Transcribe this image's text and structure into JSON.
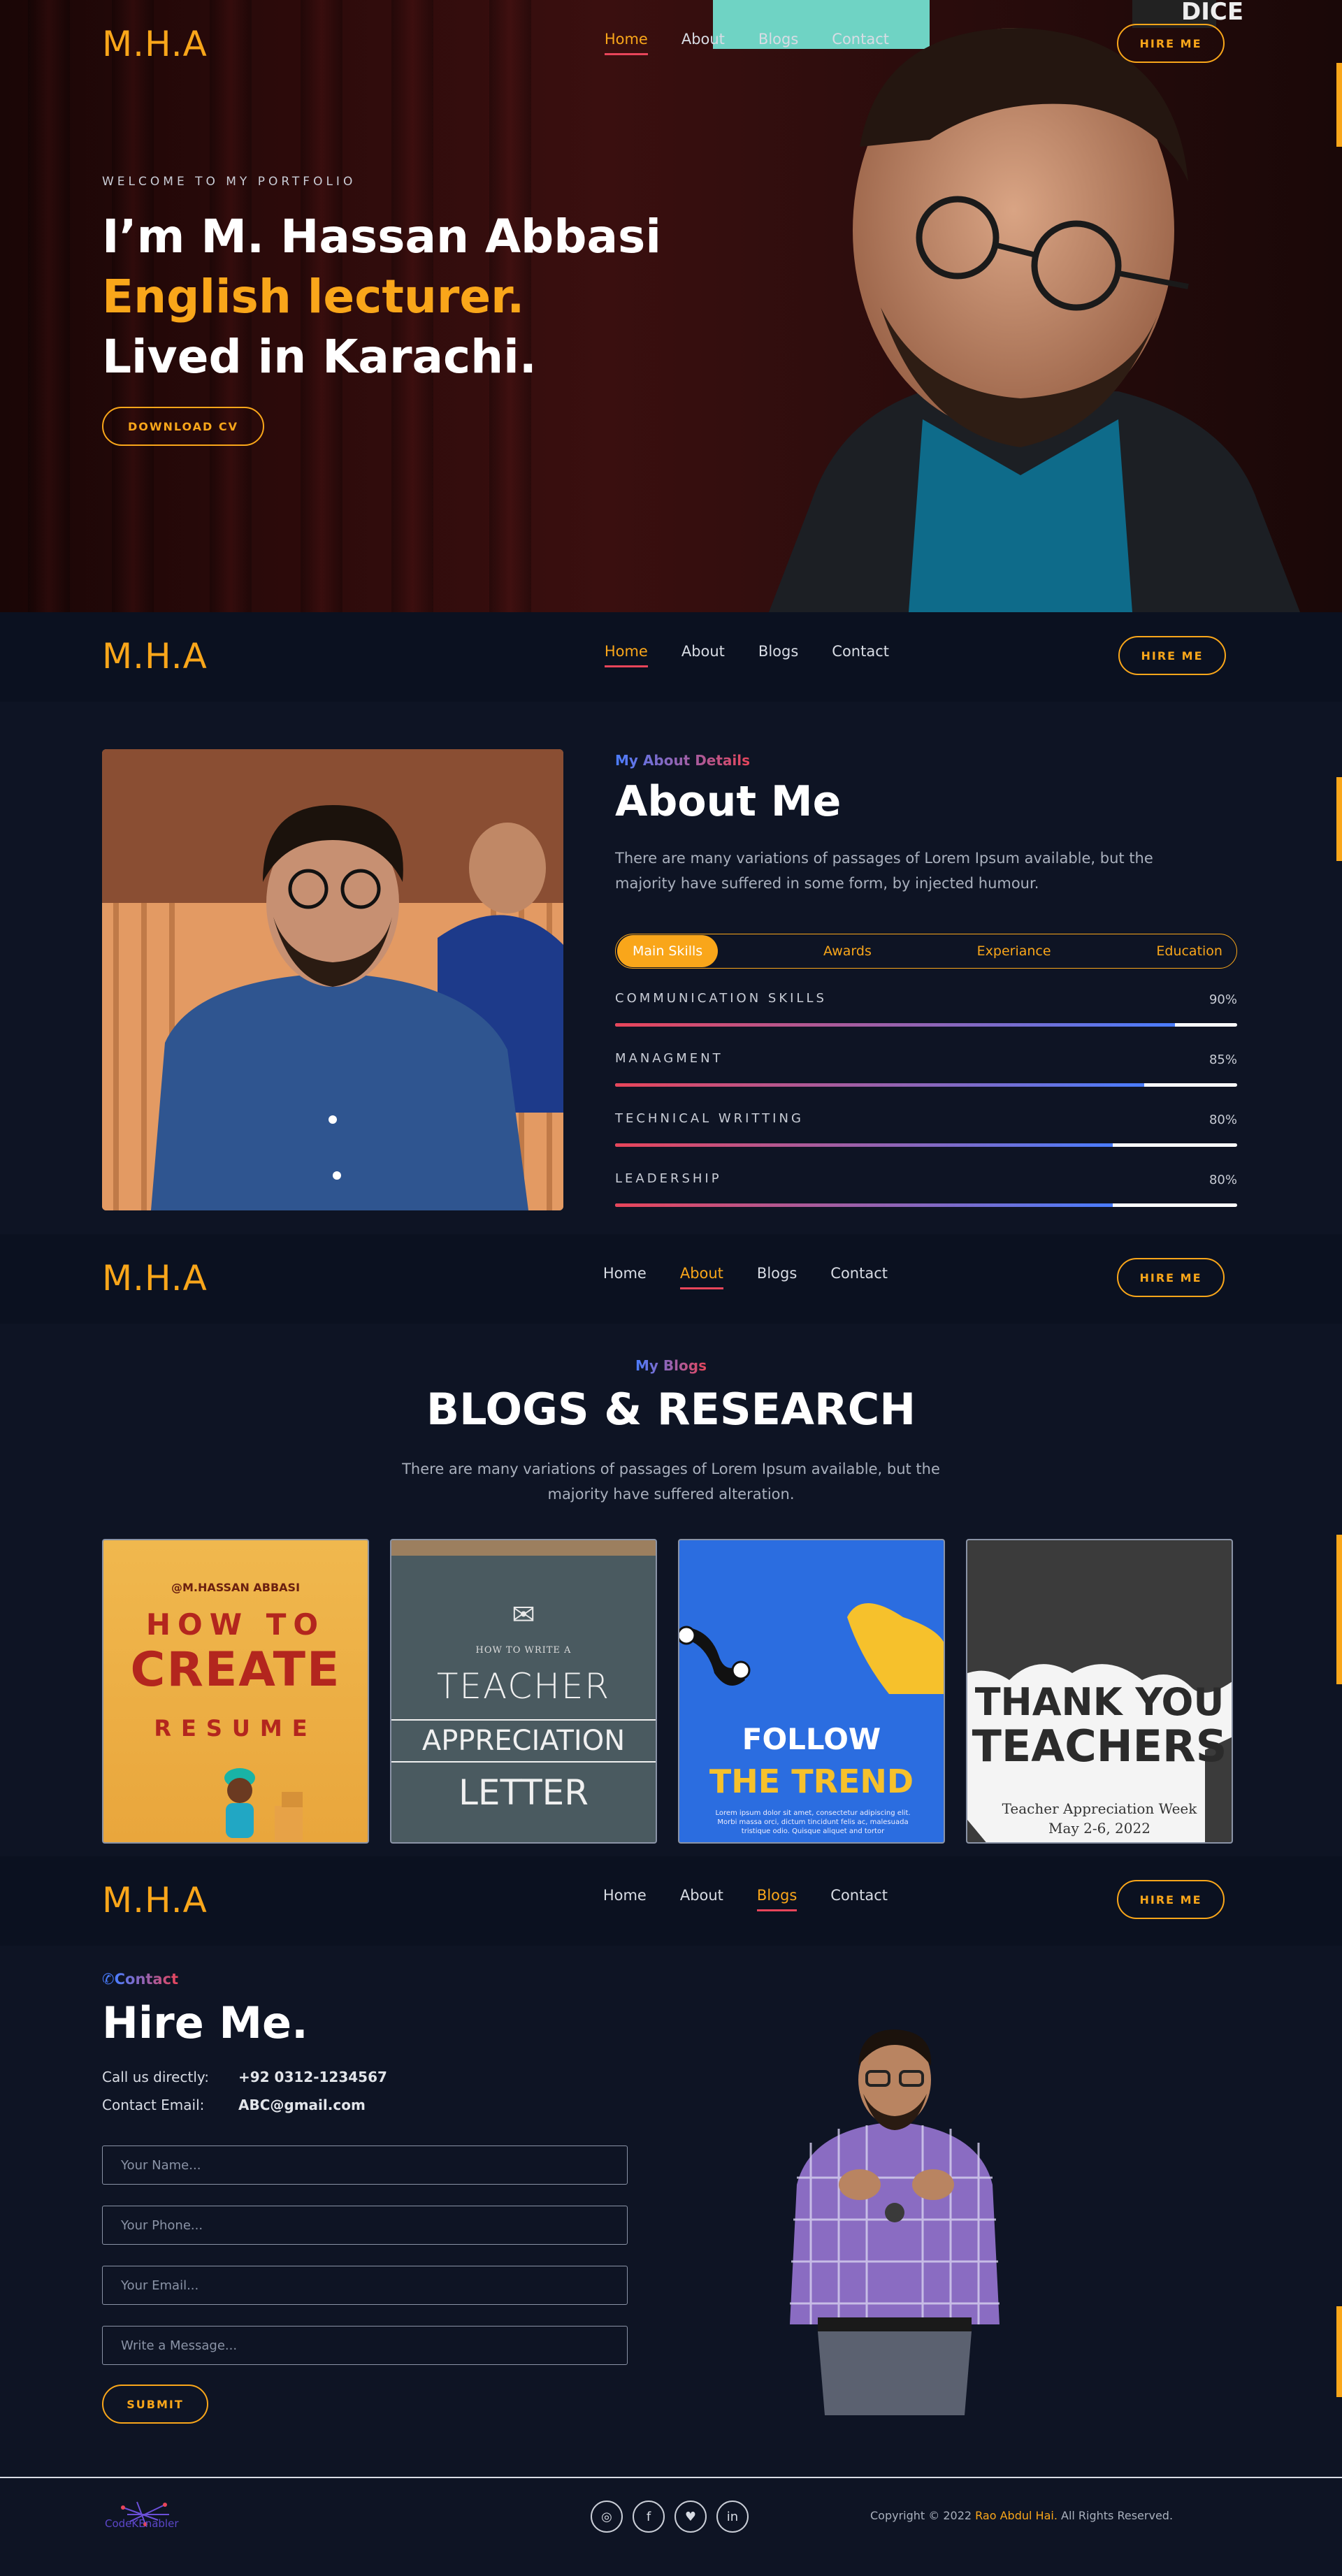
{
  "brand": {
    "logo": "M.H.A",
    "accent": "#f9a61a",
    "gradient_start": "#4a7dff",
    "gradient_end": "#e8455a",
    "background": "#0e1424"
  },
  "nav": {
    "links": [
      "Home",
      "About",
      "Blogs",
      "Contact"
    ],
    "hire_label": "HIRE ME"
  },
  "hero": {
    "welcome": "WELCOME TO MY PORTFOLIO",
    "line1": "I’m M. Hassan Abbasi",
    "line2": "English lecturer.",
    "line3": "Lived in Karachi.",
    "download_label": "DOWNLOAD CV",
    "sign_text": "DICE"
  },
  "about": {
    "tag": "My About Details",
    "title": "About Me",
    "description": "There are many variations of passages of Lorem Ipsum available, but the majority have suffered in some form, by injected humour.",
    "tabs": [
      "Main Skills",
      "Awards",
      "Experiance",
      "Education"
    ],
    "active_tab": "Main Skills",
    "skills": [
      {
        "name": "COMMUNICATION SKILLS",
        "percent_label": "90%",
        "value": 0.9
      },
      {
        "name": "MANAGMENT",
        "percent_label": "85%",
        "value": 0.85
      },
      {
        "name": "TECHNICAL WRITTING",
        "percent_label": "80%",
        "value": 0.8
      },
      {
        "name": "LEADERSHIP",
        "percent_label": "80%",
        "value": 0.8
      }
    ]
  },
  "blogs": {
    "tag": "My Blogs",
    "title": "BLOGS & RESEARCH",
    "description": "There are many variations of passages of Lorem Ipsum available, but the majority have suffered alteration.",
    "cards": [
      {
        "author": "@M.HASSAN ABBASI",
        "line1": "HOW TO",
        "line2": "CREATE",
        "line3": "RESUME"
      },
      {
        "small": "HOW TO WRITE A",
        "line1": "TEACHER",
        "line2": "APPRECIATION",
        "line3": "LETTER"
      },
      {
        "line1": "FOLLOW",
        "line2": "THE TREND",
        "small": "Lorem ipsum dolor sit amet, consectetur adipiscing elit. Morbi massa orci, dictum tincidunt felis ac, malesuada tristique odio. Quisque aliquet and tortor"
      },
      {
        "line1": "THANK YOU",
        "line2": "TEACHERS",
        "line3": "Teacher Appreciation Week",
        "line4": "May 2-6, 2022"
      }
    ]
  },
  "contact": {
    "tag": "Contact",
    "title": "Hire Me.",
    "call_label": "Call us directly:",
    "call_value": "+92 0312-1234567",
    "email_label": "Contact Email:",
    "email_value": "ABC@gmail.com",
    "placeholders": {
      "name": "Your Name...",
      "phone": "Your Phone...",
      "email": "Your Email...",
      "message": "Write a Message..."
    },
    "submit_label": "SUBMIT"
  },
  "footer": {
    "logo_text": "CodeKEnabler",
    "social": [
      "instagram-icon",
      "facebook-icon",
      "twitter-icon",
      "linkedin-icon"
    ],
    "copyright_prefix": "Copyright © 2022 ",
    "copyright_name": "Rao Abdul Hai.",
    "copyright_suffix": " All Rights Reserved."
  }
}
